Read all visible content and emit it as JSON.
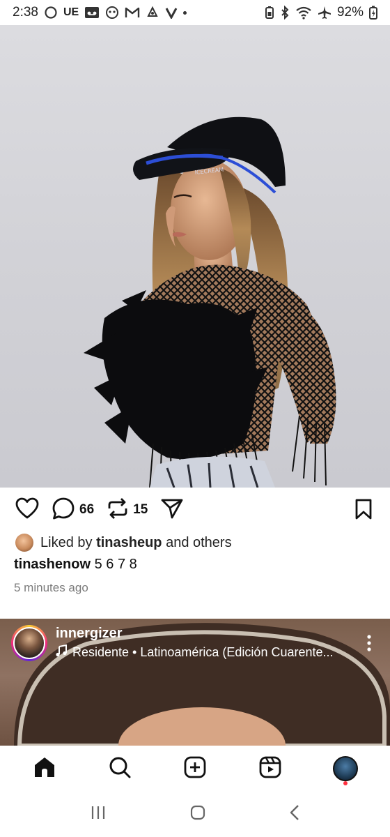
{
  "status_bar": {
    "time": "2:38",
    "indicator_text": "UE",
    "battery": "92%"
  },
  "post": {
    "comments_count": "66",
    "reposts_count": "15",
    "liked_by_prefix": "Liked by",
    "liked_by_user": "tinasheup",
    "liked_by_suffix": "and others",
    "caption_user": "tinashenow",
    "caption_text": "5 6 7 8",
    "time_ago": "5 minutes ago"
  },
  "next_post": {
    "username": "innergizer",
    "song": "Residente • Latinoamérica (Edición Cuarente..."
  },
  "colors": {
    "accent_red": "#ff3040",
    "text": "#111111",
    "muted": "#7b7b7b"
  }
}
